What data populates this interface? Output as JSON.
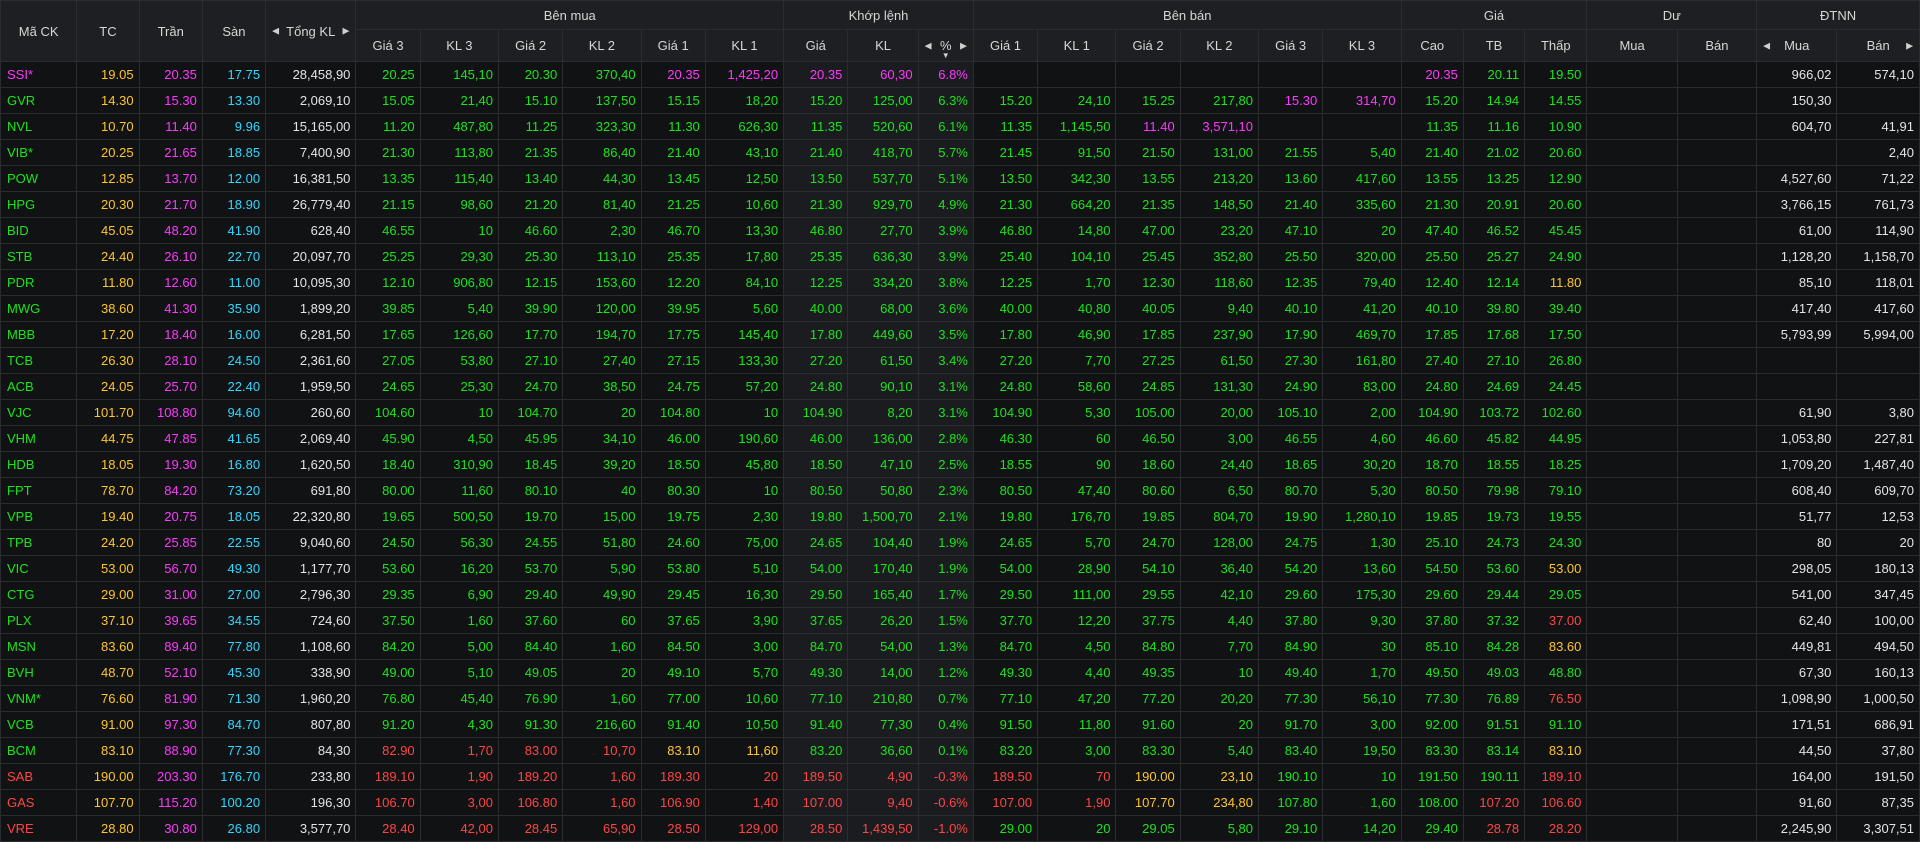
{
  "headers": {
    "symbol": "Mã CK",
    "ref": "TC",
    "ceil": "Trần",
    "floor": "Sàn",
    "total_vol": "Tổng KL",
    "buy_group": "Bên mua",
    "match_group": "Khớp lệnh",
    "sell_group": "Bên bán",
    "price_group": "Giá",
    "remain_group": "Dư",
    "foreign_group": "ĐTNN",
    "buy_cols": [
      "Giá 3",
      "KL 3",
      "Giá 2",
      "KL 2",
      "Giá 1",
      "KL 1"
    ],
    "match_cols": [
      "Giá",
      "KL",
      "%"
    ],
    "sell_cols": [
      "Giá 1",
      "KL 1",
      "Giá 2",
      "KL 2",
      "Giá 3",
      "KL 3"
    ],
    "price_cols": [
      "Cao",
      "TB",
      "Thấp"
    ],
    "remain_cols": [
      "Mua",
      "Bán"
    ],
    "foreign_cols": [
      "Mua",
      "Bán"
    ]
  },
  "icons": {
    "sort_left": "triangle-left-icon",
    "sort_right": "triangle-right-icon",
    "sort_down": "triangle-down-icon"
  },
  "colors": {
    "up": "#19e619",
    "down": "#ff4545",
    "ref": "#ffc629",
    "ceil": "#ff38ff",
    "floor": "#2fd8ff",
    "neutral": "#e4e4e4",
    "header_bg": "#1e1f23",
    "body_bg": "#111214",
    "grid": "#2a2c31"
  },
  "rows": [
    [
      "SSI*|c",
      "19.05|r",
      "20.35|c",
      "17.75|f",
      "28,458,90|w",
      "20.25|u",
      "145,10|u",
      "20.30|u",
      "370,40|u",
      "20.35|c",
      "1,425,20|c",
      "20.35|c",
      "60,30|c",
      "6.8%|c",
      "|w",
      "|w",
      "|w",
      "|w",
      "|w",
      "|w",
      "20.35|c",
      "20.11|u",
      "19.50|u",
      "|w",
      "|w",
      "966,02|w",
      "574,10|w"
    ],
    [
      "GVR|u",
      "14.30|r",
      "15.30|c",
      "13.30|f",
      "2,069,10|w",
      "15.05|u",
      "21,40|u",
      "15.10|u",
      "137,50|u",
      "15.15|u",
      "18,20|u",
      "15.20|u",
      "125,00|u",
      "6.3%|u",
      "15.20|u",
      "24,10|u",
      "15.25|u",
      "217,80|u",
      "15.30|c",
      "314,70|c",
      "15.20|u",
      "14.94|u",
      "14.55|u",
      "|w",
      "|w",
      "150,30|w",
      "|w"
    ],
    [
      "NVL|u",
      "10.70|r",
      "11.40|c",
      "9.96|f",
      "15,165,00|w",
      "11.20|u",
      "487,80|u",
      "11.25|u",
      "323,30|u",
      "11.30|u",
      "626,30|u",
      "11.35|u",
      "520,60|u",
      "6.1%|u",
      "11.35|u",
      "1,145,50|u",
      "11.40|c",
      "3,571,10|c",
      "|w",
      "|w",
      "11.35|u",
      "11.16|u",
      "10.90|u",
      "|w",
      "|w",
      "604,70|w",
      "41,91|w"
    ],
    [
      "VIB*|u",
      "20.25|r",
      "21.65|c",
      "18.85|f",
      "7,400,90|w",
      "21.30|u",
      "113,80|u",
      "21.35|u",
      "86,40|u",
      "21.40|u",
      "43,10|u",
      "21.40|u",
      "418,70|u",
      "5.7%|u",
      "21.45|u",
      "91,50|u",
      "21.50|u",
      "131,00|u",
      "21.55|u",
      "5,40|u",
      "21.40|u",
      "21.02|u",
      "20.60|u",
      "|w",
      "|w",
      "|w",
      "2,40|w"
    ],
    [
      "POW|u",
      "12.85|r",
      "13.70|c",
      "12.00|f",
      "16,381,50|w",
      "13.35|u",
      "115,40|u",
      "13.40|u",
      "44,30|u",
      "13.45|u",
      "12,50|u",
      "13.50|u",
      "537,70|u",
      "5.1%|u",
      "13.50|u",
      "342,30|u",
      "13.55|u",
      "213,20|u",
      "13.60|u",
      "417,60|u",
      "13.55|u",
      "13.25|u",
      "12.90|u",
      "|w",
      "|w",
      "4,527,60|w",
      "71,22|w"
    ],
    [
      "HPG|u",
      "20.30|r",
      "21.70|c",
      "18.90|f",
      "26,779,40|w",
      "21.15|u",
      "98,60|u",
      "21.20|u",
      "81,40|u",
      "21.25|u",
      "10,60|u",
      "21.30|u",
      "929,70|u",
      "4.9%|u",
      "21.30|u",
      "664,20|u",
      "21.35|u",
      "148,50|u",
      "21.40|u",
      "335,60|u",
      "21.30|u",
      "20.91|u",
      "20.60|u",
      "|w",
      "|w",
      "3,766,15|w",
      "761,73|w"
    ],
    [
      "BID|u",
      "45.05|r",
      "48.20|c",
      "41.90|f",
      "628,40|w",
      "46.55|u",
      "10|u",
      "46.60|u",
      "2,30|u",
      "46.70|u",
      "13,30|u",
      "46.80|u",
      "27,70|u",
      "3.9%|u",
      "46.80|u",
      "14,80|u",
      "47.00|u",
      "23,20|u",
      "47.10|u",
      "20|u",
      "47.40|u",
      "46.52|u",
      "45.45|u",
      "|w",
      "|w",
      "61,00|w",
      "114,90|w"
    ],
    [
      "STB|u",
      "24.40|r",
      "26.10|c",
      "22.70|f",
      "20,097,70|w",
      "25.25|u",
      "29,30|u",
      "25.30|u",
      "113,10|u",
      "25.35|u",
      "17,80|u",
      "25.35|u",
      "636,30|u",
      "3.9%|u",
      "25.40|u",
      "104,10|u",
      "25.45|u",
      "352,80|u",
      "25.50|u",
      "320,00|u",
      "25.50|u",
      "25.27|u",
      "24.90|u",
      "|w",
      "|w",
      "1,128,20|w",
      "1,158,70|w"
    ],
    [
      "PDR|u",
      "11.80|r",
      "12.60|c",
      "11.00|f",
      "10,095,30|w",
      "12.10|u",
      "906,80|u",
      "12.15|u",
      "153,60|u",
      "12.20|u",
      "84,10|u",
      "12.25|u",
      "334,20|u",
      "3.8%|u",
      "12.25|u",
      "1,70|u",
      "12.30|u",
      "118,60|u",
      "12.35|u",
      "79,40|u",
      "12.40|u",
      "12.14|u",
      "11.80|r",
      "|w",
      "|w",
      "85,10|w",
      "118,01|w"
    ],
    [
      "MWG|u",
      "38.60|r",
      "41.30|c",
      "35.90|f",
      "1,899,20|w",
      "39.85|u",
      "5,40|u",
      "39.90|u",
      "120,00|u",
      "39.95|u",
      "5,60|u",
      "40.00|u",
      "68,00|u",
      "3.6%|u",
      "40.00|u",
      "40,80|u",
      "40.05|u",
      "9,40|u",
      "40.10|u",
      "41,20|u",
      "40.10|u",
      "39.80|u",
      "39.40|u",
      "|w",
      "|w",
      "417,40|w",
      "417,60|w"
    ],
    [
      "MBB|u",
      "17.20|r",
      "18.40|c",
      "16.00|f",
      "6,281,50|w",
      "17.65|u",
      "126,60|u",
      "17.70|u",
      "194,70|u",
      "17.75|u",
      "145,40|u",
      "17.80|u",
      "449,60|u",
      "3.5%|u",
      "17.80|u",
      "46,90|u",
      "17.85|u",
      "237,90|u",
      "17.90|u",
      "469,70|u",
      "17.85|u",
      "17.68|u",
      "17.50|u",
      "|w",
      "|w",
      "5,793,99|w",
      "5,994,00|w"
    ],
    [
      "TCB|u",
      "26.30|r",
      "28.10|c",
      "24.50|f",
      "2,361,60|w",
      "27.05|u",
      "53,80|u",
      "27.10|u",
      "27,40|u",
      "27.15|u",
      "133,30|u",
      "27.20|u",
      "61,50|u",
      "3.4%|u",
      "27.20|u",
      "7,70|u",
      "27.25|u",
      "61,50|u",
      "27.30|u",
      "161,80|u",
      "27.40|u",
      "27.10|u",
      "26.80|u",
      "|w",
      "|w",
      "|w",
      "|w"
    ],
    [
      "ACB|u",
      "24.05|r",
      "25.70|c",
      "22.40|f",
      "1,959,50|w",
      "24.65|u",
      "25,30|u",
      "24.70|u",
      "38,50|u",
      "24.75|u",
      "57,20|u",
      "24.80|u",
      "90,10|u",
      "3.1%|u",
      "24.80|u",
      "58,60|u",
      "24.85|u",
      "131,30|u",
      "24.90|u",
      "83,00|u",
      "24.80|u",
      "24.69|u",
      "24.45|u",
      "|w",
      "|w",
      "|w",
      "|w"
    ],
    [
      "VJC|u",
      "101.70|r",
      "108.80|c",
      "94.60|f",
      "260,60|w",
      "104.60|u",
      "10|u",
      "104.70|u",
      "20|u",
      "104.80|u",
      "10|u",
      "104.90|u",
      "8,20|u",
      "3.1%|u",
      "104.90|u",
      "5,30|u",
      "105.00|u",
      "20,00|u",
      "105.10|u",
      "2,00|u",
      "104.90|u",
      "103.72|u",
      "102.60|u",
      "|w",
      "|w",
      "61,90|w",
      "3,80|w"
    ],
    [
      "VHM|u",
      "44.75|r",
      "47.85|c",
      "41.65|f",
      "2,069,40|w",
      "45.90|u",
      "4,50|u",
      "45.95|u",
      "34,10|u",
      "46.00|u",
      "190,60|u",
      "46.00|u",
      "136,00|u",
      "2.8%|u",
      "46.30|u",
      "60|u",
      "46.50|u",
      "3,00|u",
      "46.55|u",
      "4,60|u",
      "46.60|u",
      "45.82|u",
      "44.95|u",
      "|w",
      "|w",
      "1,053,80|w",
      "227,81|w"
    ],
    [
      "HDB|u",
      "18.05|r",
      "19.30|c",
      "16.80|f",
      "1,620,50|w",
      "18.40|u",
      "310,90|u",
      "18.45|u",
      "39,20|u",
      "18.50|u",
      "45,80|u",
      "18.50|u",
      "47,10|u",
      "2.5%|u",
      "18.55|u",
      "90|u",
      "18.60|u",
      "24,40|u",
      "18.65|u",
      "30,20|u",
      "18.70|u",
      "18.55|u",
      "18.25|u",
      "|w",
      "|w",
      "1,709,20|w",
      "1,487,40|w"
    ],
    [
      "FPT|u",
      "78.70|r",
      "84.20|c",
      "73.20|f",
      "691,80|w",
      "80.00|u",
      "11,60|u",
      "80.10|u",
      "40|u",
      "80.30|u",
      "10|u",
      "80.50|u",
      "50,80|u",
      "2.3%|u",
      "80.50|u",
      "47,40|u",
      "80.60|u",
      "6,50|u",
      "80.70|u",
      "5,30|u",
      "80.50|u",
      "79.98|u",
      "79.10|u",
      "|w",
      "|w",
      "608,40|w",
      "609,70|w"
    ],
    [
      "VPB|u",
      "19.40|r",
      "20.75|c",
      "18.05|f",
      "22,320,80|w",
      "19.65|u",
      "500,50|u",
      "19.70|u",
      "15,00|u",
      "19.75|u",
      "2,30|u",
      "19.80|u",
      "1,500,70|u",
      "2.1%|u",
      "19.80|u",
      "176,70|u",
      "19.85|u",
      "804,70|u",
      "19.90|u",
      "1,280,10|u",
      "19.85|u",
      "19.73|u",
      "19.55|u",
      "|w",
      "|w",
      "51,77|w",
      "12,53|w"
    ],
    [
      "TPB|u",
      "24.20|r",
      "25.85|c",
      "22.55|f",
      "9,040,60|w",
      "24.50|u",
      "56,30|u",
      "24.55|u",
      "51,80|u",
      "24.60|u",
      "75,00|u",
      "24.65|u",
      "104,40|u",
      "1.9%|u",
      "24.65|u",
      "5,70|u",
      "24.70|u",
      "128,00|u",
      "24.75|u",
      "1,30|u",
      "25.10|u",
      "24.73|u",
      "24.30|u",
      "|w",
      "|w",
      "80|w",
      "20|w"
    ],
    [
      "VIC|u",
      "53.00|r",
      "56.70|c",
      "49.30|f",
      "1,177,70|w",
      "53.60|u",
      "16,20|u",
      "53.70|u",
      "5,90|u",
      "53.80|u",
      "5,10|u",
      "54.00|u",
      "170,40|u",
      "1.9%|u",
      "54.00|u",
      "28,90|u",
      "54.10|u",
      "36,40|u",
      "54.20|u",
      "13,60|u",
      "54.50|u",
      "53.60|u",
      "53.00|r",
      "|w",
      "|w",
      "298,05|w",
      "180,13|w"
    ],
    [
      "CTG|u",
      "29.00|r",
      "31.00|c",
      "27.00|f",
      "2,796,30|w",
      "29.35|u",
      "6,90|u",
      "29.40|u",
      "49,90|u",
      "29.45|u",
      "16,30|u",
      "29.50|u",
      "165,40|u",
      "1.7%|u",
      "29.50|u",
      "111,00|u",
      "29.55|u",
      "42,10|u",
      "29.60|u",
      "175,30|u",
      "29.60|u",
      "29.44|u",
      "29.05|u",
      "|w",
      "|w",
      "541,00|w",
      "347,45|w"
    ],
    [
      "PLX|u",
      "37.10|r",
      "39.65|c",
      "34.55|f",
      "724,60|w",
      "37.50|u",
      "1,60|u",
      "37.60|u",
      "60|u",
      "37.65|u",
      "3,90|u",
      "37.65|u",
      "26,20|u",
      "1.5%|u",
      "37.70|u",
      "12,20|u",
      "37.75|u",
      "4,40|u",
      "37.80|u",
      "9,30|u",
      "37.80|u",
      "37.32|u",
      "37.00|d",
      "|w",
      "|w",
      "62,40|w",
      "100,00|w"
    ],
    [
      "MSN|u",
      "83.60|r",
      "89.40|c",
      "77.80|f",
      "1,108,60|w",
      "84.20|u",
      "5,00|u",
      "84.40|u",
      "1,60|u",
      "84.50|u",
      "3,00|u",
      "84.70|u",
      "54,00|u",
      "1.3%|u",
      "84.70|u",
      "4,50|u",
      "84.80|u",
      "7,70|u",
      "84.90|u",
      "30|u",
      "85.10|u",
      "84.28|u",
      "83.60|r",
      "|w",
      "|w",
      "449,81|w",
      "494,50|w"
    ],
    [
      "BVH|u",
      "48.70|r",
      "52.10|c",
      "45.30|f",
      "338,90|w",
      "49.00|u",
      "5,10|u",
      "49.05|u",
      "20|u",
      "49.10|u",
      "5,70|u",
      "49.30|u",
      "14,00|u",
      "1.2%|u",
      "49.30|u",
      "4,40|u",
      "49.35|u",
      "10|u",
      "49.40|u",
      "1,70|u",
      "49.50|u",
      "49.03|u",
      "48.80|u",
      "|w",
      "|w",
      "67,30|w",
      "160,13|w"
    ],
    [
      "VNM*|u",
      "76.60|r",
      "81.90|c",
      "71.30|f",
      "1,960,20|w",
      "76.80|u",
      "45,40|u",
      "76.90|u",
      "1,60|u",
      "77.00|u",
      "10,60|u",
      "77.10|u",
      "210,80|u",
      "0.7%|u",
      "77.10|u",
      "47,20|u",
      "77.20|u",
      "20,20|u",
      "77.30|u",
      "56,10|u",
      "77.30|u",
      "76.89|u",
      "76.50|d",
      "|w",
      "|w",
      "1,098,90|w",
      "1,000,50|w"
    ],
    [
      "VCB|u",
      "91.00|r",
      "97.30|c",
      "84.70|f",
      "807,80|w",
      "91.20|u",
      "4,30|u",
      "91.30|u",
      "216,60|u",
      "91.40|u",
      "10,50|u",
      "91.40|u",
      "77,30|u",
      "0.4%|u",
      "91.50|u",
      "11,80|u",
      "91.60|u",
      "20|u",
      "91.70|u",
      "3,00|u",
      "92.00|u",
      "91.51|u",
      "91.10|u",
      "|w",
      "|w",
      "171,51|w",
      "686,91|w"
    ],
    [
      "BCM|u",
      "83.10|r",
      "88.90|c",
      "77.30|f",
      "84,30|w",
      "82.90|d",
      "1,70|d",
      "83.00|d",
      "10,70|d",
      "83.10|r",
      "11,60|r",
      "83.20|u",
      "36,60|u",
      "0.1%|u",
      "83.20|u",
      "3,00|u",
      "83.30|u",
      "5,40|u",
      "83.40|u",
      "19,50|u",
      "83.30|u",
      "83.14|u",
      "83.10|r",
      "|w",
      "|w",
      "44,50|w",
      "37,80|w"
    ],
    [
      "SAB|d",
      "190.00|r",
      "203.30|c",
      "176.70|f",
      "233,80|w",
      "189.10|d",
      "1,90|d",
      "189.20|d",
      "1,60|d",
      "189.30|d",
      "20|d",
      "189.50|d",
      "4,90|d",
      "-0.3%|d",
      "189.50|d",
      "70|d",
      "190.00|r",
      "23,10|r",
      "190.10|u",
      "10|u",
      "191.50|u",
      "190.11|u",
      "189.10|d",
      "|w",
      "|w",
      "164,00|w",
      "191,50|w"
    ],
    [
      "GAS|d",
      "107.70|r",
      "115.20|c",
      "100.20|f",
      "196,30|w",
      "106.70|d",
      "3,00|d",
      "106.80|d",
      "1,60|d",
      "106.90|d",
      "1,40|d",
      "107.00|d",
      "9,40|d",
      "-0.6%|d",
      "107.00|d",
      "1,90|d",
      "107.70|r",
      "234,80|r",
      "107.80|u",
      "1,60|u",
      "108.00|u",
      "107.20|d",
      "106.60|d",
      "|w",
      "|w",
      "91,60|w",
      "87,35|w"
    ],
    [
      "VRE|d",
      "28.80|r",
      "30.80|c",
      "26.80|f",
      "3,577,70|w",
      "28.40|d",
      "42,00|d",
      "28.45|d",
      "65,90|d",
      "28.50|d",
      "129,00|d",
      "28.50|d",
      "1,439,50|d",
      "-1.0%|d",
      "29.00|u",
      "20|u",
      "29.05|u",
      "5,80|u",
      "29.10|u",
      "14,20|u",
      "29.40|u",
      "28.78|d",
      "28.20|d",
      "|w",
      "|w",
      "2,245,90|w",
      "3,307,51|w"
    ]
  ]
}
